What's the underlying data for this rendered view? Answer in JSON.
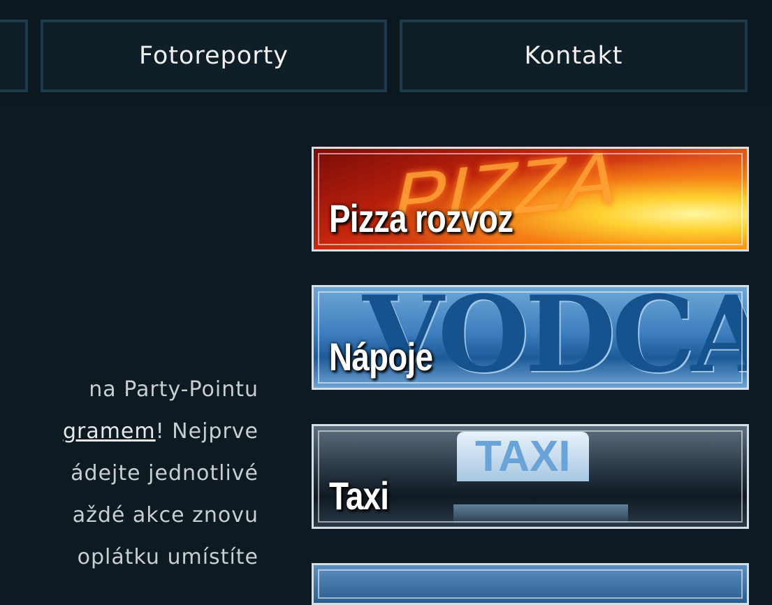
{
  "nav": {
    "items": [
      {
        "label": ""
      },
      {
        "label": "Fotoreporty"
      },
      {
        "label": "Kontakt"
      }
    ]
  },
  "content": {
    "lines": [
      "na  Party-Pointu",
      "! Nejprve",
      "ádejte  jednotlivé",
      "aždé  akce  znovu",
      "oplátku  umístíte"
    ],
    "link_text": "gramem"
  },
  "banners": {
    "pizza": {
      "label": "Pizza rozvoz",
      "bg_word": "PIZZA"
    },
    "napoje": {
      "label": "Nápoje",
      "bg_word": "VODCA"
    },
    "taxi": {
      "label": "Taxi",
      "bg_word": "TAXI"
    }
  }
}
